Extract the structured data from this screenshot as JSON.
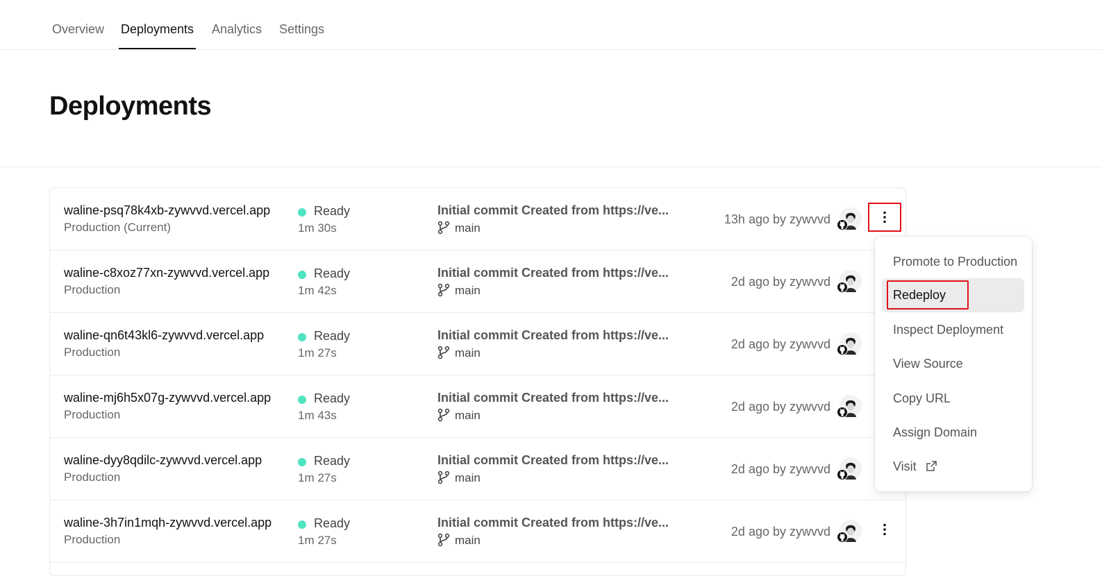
{
  "tabs": [
    {
      "label": "Overview"
    },
    {
      "label": "Deployments"
    },
    {
      "label": "Analytics"
    },
    {
      "label": "Settings"
    }
  ],
  "page_title": "Deployments",
  "colors": {
    "ready": "#50e3c2",
    "highlight": "#e0101a"
  },
  "deployments": [
    {
      "url": "waline-psq78k4xb-zywvvd.vercel.app",
      "env": "Production (Current)",
      "status": "Ready",
      "duration": "1m 30s",
      "commit": "Initial commit Created from https://ve...",
      "branch": "main",
      "time": "13h ago by zywvvd"
    },
    {
      "url": "waline-c8xoz77xn-zywvvd.vercel.app",
      "env": "Production",
      "status": "Ready",
      "duration": "1m 42s",
      "commit": "Initial commit Created from https://ve...",
      "branch": "main",
      "time": "2d ago by zywvvd"
    },
    {
      "url": "waline-qn6t43kl6-zywvvd.vercel.app",
      "env": "Production",
      "status": "Ready",
      "duration": "1m 27s",
      "commit": "Initial commit Created from https://ve...",
      "branch": "main",
      "time": "2d ago by zywvvd"
    },
    {
      "url": "waline-mj6h5x07g-zywvvd.vercel.app",
      "env": "Production",
      "status": "Ready",
      "duration": "1m 43s",
      "commit": "Initial commit Created from https://ve...",
      "branch": "main",
      "time": "2d ago by zywvvd"
    },
    {
      "url": "waline-dyy8qdilc-zywvvd.vercel.app",
      "env": "Production",
      "status": "Ready",
      "duration": "1m 27s",
      "commit": "Initial commit Created from https://ve...",
      "branch": "main",
      "time": "2d ago by zywvvd"
    },
    {
      "url": "waline-3h7in1mqh-zywvvd.vercel.app",
      "env": "Production",
      "status": "Ready",
      "duration": "1m 27s",
      "commit": "Initial commit Created from https://ve...",
      "branch": "main",
      "time": "2d ago by zywvvd"
    }
  ],
  "menu": {
    "items": [
      {
        "label": "Promote to Production"
      },
      {
        "label": "Redeploy"
      },
      {
        "label": "Inspect Deployment"
      },
      {
        "label": "View Source"
      },
      {
        "label": "Copy URL"
      },
      {
        "label": "Assign Domain"
      },
      {
        "label": "Visit"
      }
    ]
  },
  "icons": {
    "kebab": "more-vertical-icon",
    "branch": "git-branch-icon",
    "external": "external-link-icon",
    "github": "github-icon"
  }
}
